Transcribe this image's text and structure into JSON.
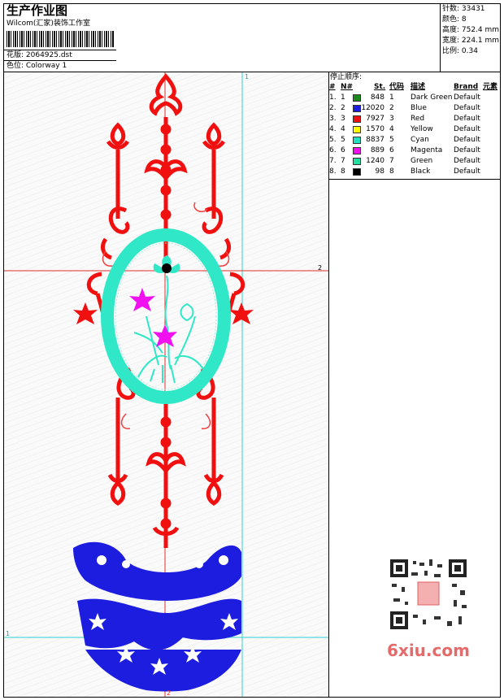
{
  "header": {
    "title": "生产作业图",
    "company": "Wilcom(汇家)装饰工作室",
    "design_label": "花版: 2064925.dst",
    "colorway_label": "色位: Colorway 1"
  },
  "stats": {
    "stitches": "针数: 33431",
    "colors": "颜色: 8",
    "height": "高度: 752.4 mm",
    "width": "宽度: 224.1 mm",
    "scale": "比例: 0.34"
  },
  "stop_sequence": {
    "title": "停止顺序:",
    "columns": [
      "#",
      "N#",
      "St.",
      "代码",
      "描述",
      "Brand",
      "元素"
    ],
    "rows": [
      {
        "idx": "1.",
        "n": "1",
        "st": "848",
        "code": "1",
        "desc": "Dark Green",
        "brand": "Default",
        "color": "#1a8a1a"
      },
      {
        "idx": "2.",
        "n": "2",
        "st": "12020",
        "code": "2",
        "desc": "Blue",
        "brand": "Default",
        "color": "#1d1de0"
      },
      {
        "idx": "3.",
        "n": "3",
        "st": "7927",
        "code": "3",
        "desc": "Red",
        "brand": "Default",
        "color": "#f01010"
      },
      {
        "idx": "4.",
        "n": "4",
        "st": "1570",
        "code": "4",
        "desc": "Yellow",
        "brand": "Default",
        "color": "#ffff00"
      },
      {
        "idx": "5.",
        "n": "5",
        "st": "8837",
        "code": "5",
        "desc": "Cyan",
        "brand": "Default",
        "color": "#20e0c0"
      },
      {
        "idx": "6.",
        "n": "6",
        "st": "889",
        "code": "6",
        "desc": "Magenta",
        "brand": "Default",
        "color": "#f010f0"
      },
      {
        "idx": "7.",
        "n": "7",
        "st": "1240",
        "code": "7",
        "desc": "Green",
        "brand": "Default",
        "color": "#20e0a0"
      },
      {
        "idx": "8.",
        "n": "8",
        "st": "98",
        "code": "8",
        "desc": "Black",
        "brand": "Default",
        "color": "#000000"
      }
    ]
  },
  "guides": {
    "v1": "1",
    "h2": "2",
    "h1": "1",
    "v2": "2"
  },
  "watermark": {
    "text": "6xiu.com"
  },
  "colors": {
    "red": "#f01010",
    "blue": "#1d1de0",
    "cyan": "#30e8c8",
    "magenta": "#f010f0",
    "guide_red": "#e03030",
    "guide_cyan": "#30d0d0"
  },
  "icons": {
    "qr": "qr-code-icon",
    "seal": "seal-icon"
  }
}
